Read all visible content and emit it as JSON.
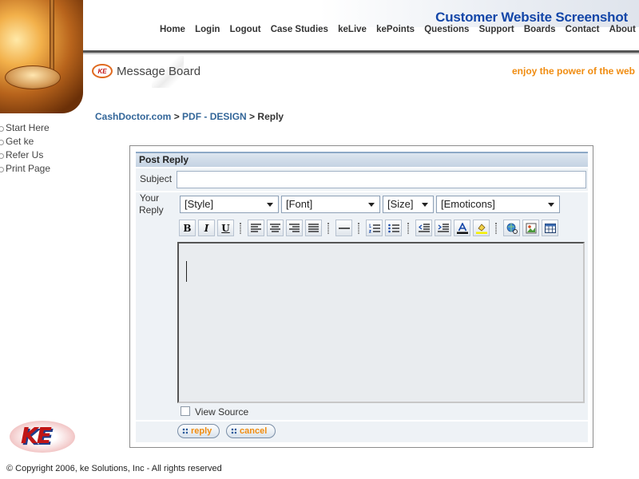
{
  "header": {
    "site_title": "Customer Website Screenshot",
    "nav": [
      "Home",
      "Login",
      "Logout",
      "Case Studies",
      "keLive",
      "kePoints",
      "Questions",
      "Support",
      "Boards",
      "Contact",
      "About"
    ]
  },
  "board": {
    "logo_text": "KE",
    "title": "Message Board",
    "tagline": "enjoy the power of the web"
  },
  "side_menu": [
    "Start Here",
    "Get ke",
    "Refer Us",
    "Print Page"
  ],
  "breadcrumb": {
    "crumb1": "CashDoctor.com",
    "sep1": " > ",
    "crumb2": "PDF - DESIGN",
    "sep2": " > ",
    "current": "Reply"
  },
  "form": {
    "header": "Post Reply",
    "subject_label": "Subject",
    "subject_value": "",
    "reply_label_line1": "Your",
    "reply_label_line2": "Reply",
    "dropdowns": {
      "style": "[Style]",
      "font": "[Font]",
      "size": "[Size]",
      "emoticons": "[Emoticons]"
    },
    "toolbar": {
      "bold": "B",
      "italic": "I",
      "underline": "U"
    },
    "view_source_label": "View Source",
    "view_source_checked": false,
    "reply_button": "reply",
    "cancel_button": "cancel"
  },
  "footer": {
    "logo_text": "KE",
    "copyright": "© Copyright 2006, ke Solutions, Inc - All rights reserved"
  },
  "colors": {
    "title_blue": "#1346a8",
    "accent_orange": "#f08c10",
    "link_blue": "#336699"
  }
}
